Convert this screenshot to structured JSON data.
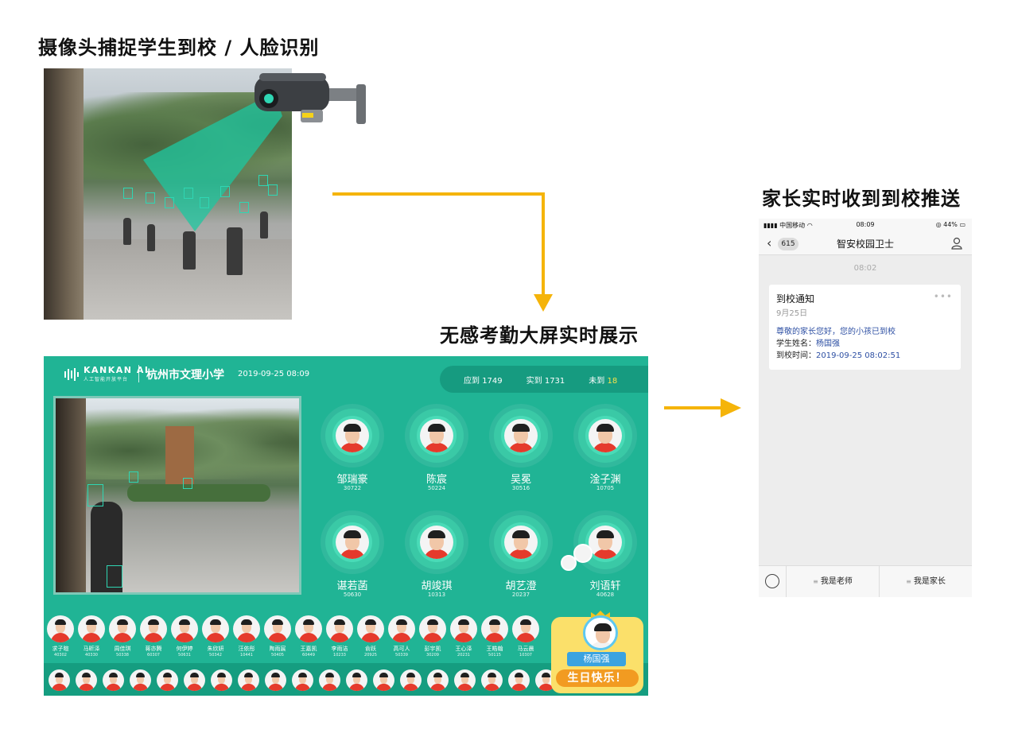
{
  "headings": {
    "camera": "摄像头捕捉学生到校 / 人脸识别",
    "bigscreen": "无感考勤大屏实时展示",
    "parent": "家长实时收到到校推送"
  },
  "bigscreen": {
    "brand": "KANKAN AI",
    "brand_sub": "人工智能开放平台",
    "school": "杭州市文理小学",
    "datetime": "2019-09-25 08:09",
    "stats": {
      "expected_label": "应到",
      "expected_value": "1749",
      "actual_label": "实到",
      "actual_value": "1731",
      "absent_label": "未到",
      "absent_value": "18"
    },
    "featured": [
      {
        "name": "邹瑞豪",
        "id": "30722"
      },
      {
        "name": "陈宸",
        "id": "50224"
      },
      {
        "name": "吴冕",
        "id": "30516"
      },
      {
        "name": "淦子渊",
        "id": "10705"
      },
      {
        "name": "谌若菡",
        "id": "50630"
      },
      {
        "name": "胡竣琪",
        "id": "10313"
      },
      {
        "name": "胡艺澄",
        "id": "20237"
      },
      {
        "name": "刘语轩",
        "id": "40628"
      }
    ],
    "row1": [
      {
        "name": "求子暄",
        "id": "40302"
      },
      {
        "name": "马昕泽",
        "id": "40330"
      },
      {
        "name": "周佳琪",
        "id": "50338"
      },
      {
        "name": "蒋亦腾",
        "id": "60307"
      },
      {
        "name": "何伊婷",
        "id": "50631"
      },
      {
        "name": "朱欣妍",
        "id": "50342"
      },
      {
        "name": "汪依彤",
        "id": "10441"
      },
      {
        "name": "陶雨宸",
        "id": "50405"
      },
      {
        "name": "王嘉凯",
        "id": "60449"
      },
      {
        "name": "李雨洁",
        "id": "10233"
      },
      {
        "name": "俞跃",
        "id": "20925"
      },
      {
        "name": "高可人",
        "id": "50339"
      },
      {
        "name": "彭宇凯",
        "id": "30209"
      },
      {
        "name": "王心泽",
        "id": "20231"
      },
      {
        "name": "王皓翰",
        "id": "50115"
      },
      {
        "name": "马云晨",
        "id": "10307"
      }
    ],
    "birthday": {
      "name": "杨国强",
      "text": "生日快乐！"
    }
  },
  "phone": {
    "carrier": "中国移动",
    "clock": "08:09",
    "battery": "44%",
    "badge": "615",
    "title": "智安校园卫士",
    "msg_time": "08:02",
    "card": {
      "title": "到校通知",
      "date": "9月25日",
      "greeting": "尊敬的家长您好，您的小孩已到校",
      "name_label": "学生姓名：",
      "name_value": "杨国强",
      "time_label": "到校时间：",
      "time_value": "2019-09-25 08:02:51"
    },
    "menu": {
      "teacher": "我是老师",
      "parent": "我是家长"
    }
  },
  "colors": {
    "screen_green": "#20b495",
    "arrow_yellow": "#f5b40a",
    "link_blue": "#2d4fa3"
  }
}
